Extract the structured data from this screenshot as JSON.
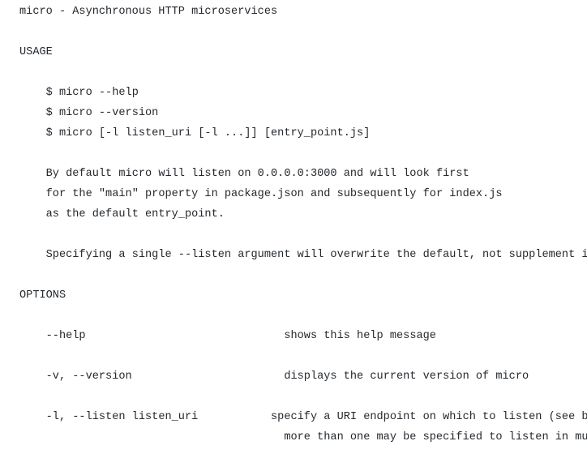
{
  "help": {
    "title": "micro - Asynchronous HTTP microservices",
    "usage_header": "USAGE",
    "usage_lines": [
      "$ micro --help",
      "$ micro --version",
      "$ micro [-l listen_uri [-l ...]] [entry_point.js]"
    ],
    "usage_desc": [
      "By default micro will listen on 0.0.0.0:3000 and will look first",
      "for the \"main\" property in package.json and subsequently for index.js",
      "as the default entry_point."
    ],
    "usage_note": "Specifying a single --listen argument will overwrite the default, not supplement it.",
    "options_header": "OPTIONS",
    "options": [
      {
        "flag": "--help",
        "desc": "shows this help message"
      },
      {
        "flag": "-v, --version",
        "desc": "displays the current version of micro"
      },
      {
        "flag": "-l, --listen listen_uri",
        "desc_line1": "specify a URI endpoint on which to listen (see below) -",
        "desc_line2": "more than one may be specified to listen in multiple places"
      }
    ]
  }
}
